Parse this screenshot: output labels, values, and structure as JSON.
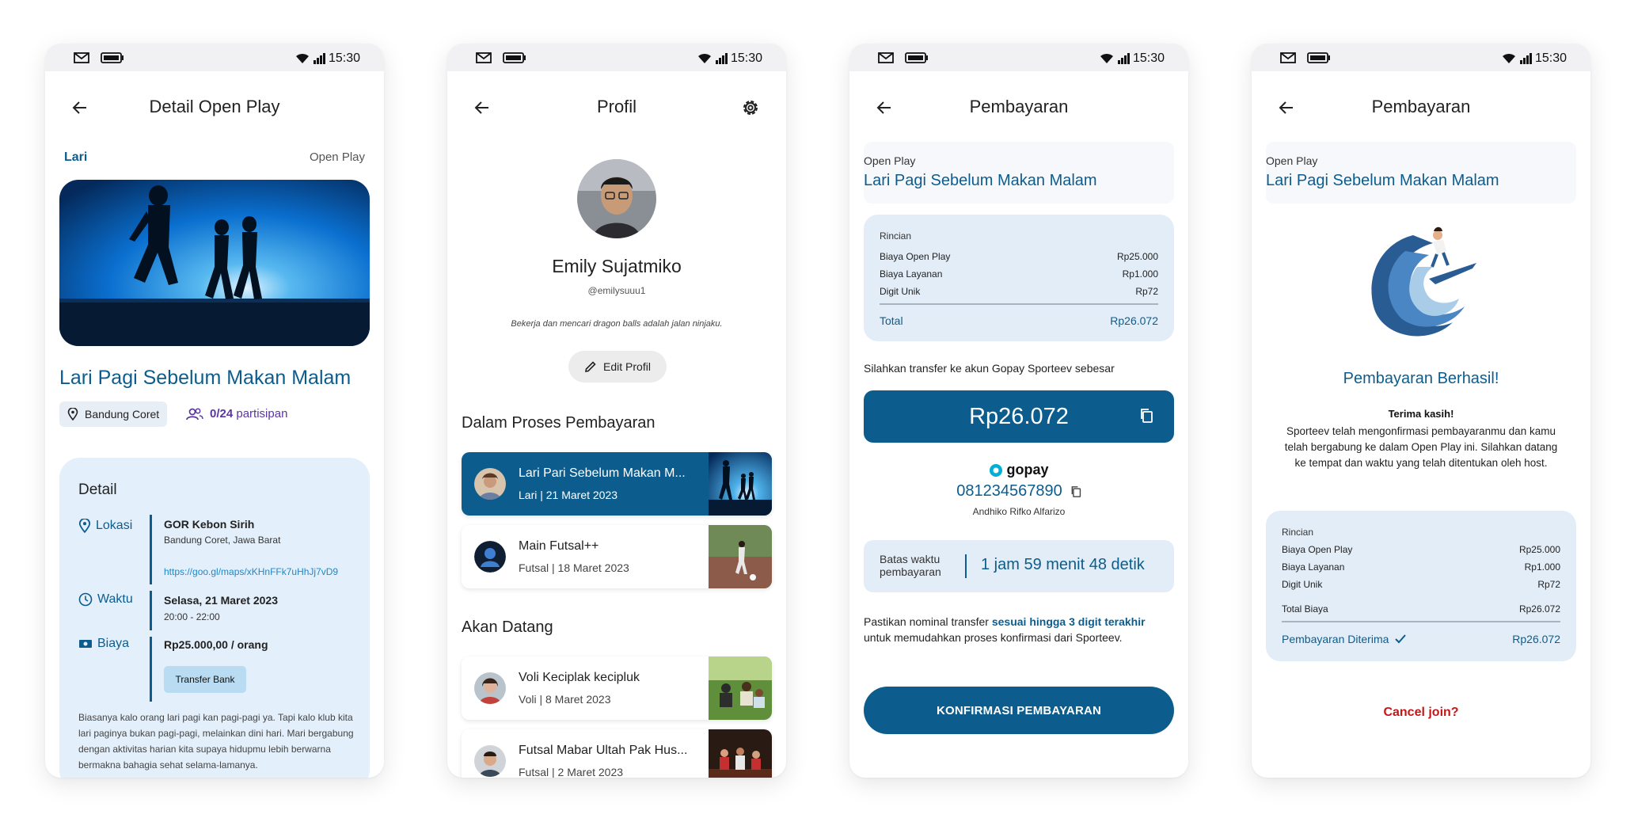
{
  "status_bar": {
    "time": "15:30"
  },
  "screen1": {
    "title": "Detail Open Play",
    "category": "Lari",
    "type": "Open Play",
    "event_title": "Lari Pagi Sebelum Makan Malam",
    "location_chip": "Bandung Coret",
    "participants_count": "0/24",
    "participants_label": "partisipan",
    "detail_title": "Detail",
    "lokasi_label": "Lokasi",
    "lokasi_name": "GOR Kebon Sirih",
    "lokasi_city": "Bandung Coret, Jawa Barat",
    "lokasi_link": "https://goo.gl/maps/xKHnFFk7uHhJj7vD9",
    "waktu_label": "Waktu",
    "waktu_date": "Selasa, 21 Maret 2023",
    "waktu_time": "20:00 - 22:00",
    "biaya_label": "Biaya",
    "biaya_value": "Rp25.000,00 / orang",
    "transfer_button": "Transfer Bank",
    "description": "Biasanya kalo orang lari pagi kan pagi-pagi ya. Tapi kalo klub kita lari paginya bukan pagi-pagi, melainkan dini hari. Mari bergabung dengan aktivitas harian kita supaya hidupmu lebih berwarna bermakna bahagia sehat selama-lamanya."
  },
  "screen2": {
    "title": "Profil",
    "name": "Emily Sujatmiko",
    "username": "@emilysuuu1",
    "bio": "Bekerja dan mencari dragon balls adalah jalan ninjaku.",
    "edit_button": "Edit Profil",
    "section_payment": "Dalam Proses Pembayaran",
    "payment_items": [
      {
        "title": "Lari Pari Sebelum Makan M...",
        "subtitle": "Lari | 21 Maret 2023"
      },
      {
        "title": "Main Futsal++",
        "subtitle": "Futsal | 18 Maret 2023"
      }
    ],
    "section_upcoming": "Akan Datang",
    "upcoming_items": [
      {
        "title": "Voli Keciplak kecipluk",
        "subtitle": "Voli | 8 Maret 2023"
      },
      {
        "title": "Futsal Mabar Ultah Pak Hus...",
        "subtitle": "Futsal | 2 Maret 2023"
      }
    ]
  },
  "screen3": {
    "title": "Pembayaran",
    "event_label": "Open Play",
    "event_title": "Lari Pagi Sebelum Makan Malam",
    "rincian_title": "Rincian",
    "rows": [
      {
        "label": "Biaya Open Play",
        "value": "Rp25.000"
      },
      {
        "label": "Biaya Layanan",
        "value": "Rp1.000"
      },
      {
        "label": "Digit Unik",
        "value": "Rp72"
      }
    ],
    "total_label": "Total",
    "total_value": "Rp26.072",
    "transfer_note": "Silahkan transfer ke akun Gopay Sporteev sebesar",
    "amount": "Rp26.072",
    "gopay_brand": "gopay",
    "phone_number": "081234567890",
    "account_name": "Andhiko Rifko Alfarizo",
    "deadline_label_1": "Batas waktu",
    "deadline_label_2": "pembayaran",
    "deadline_value": "1 jam 59 menit 48 detik",
    "note_prefix": "Pastikan nominal transfer ",
    "note_bold": "sesuai hingga 3 digit terakhir",
    "note_suffix": "untuk memudahkan proses konfirmasi dari Sporteev.",
    "confirm_button": "KONFIRMASI PEMBAYARAN"
  },
  "screen4": {
    "title": "Pembayaran",
    "event_label": "Open Play",
    "event_title": "Lari Pagi Sebelum Makan Malam",
    "success_title": "Pembayaran Berhasil!",
    "thanks": "Terima kasih!",
    "success_desc": "Sporteev telah mengonfirmasi pembayaranmu dan kamu telah bergabung ke dalam Open Play ini. Silahkan datang ke tempat dan waktu yang telah ditentukan oleh host.",
    "rincian_title": "Rincian",
    "rows": [
      {
        "label": "Biaya Open Play",
        "value": "Rp25.000"
      },
      {
        "label": "Biaya Layanan",
        "value": "Rp1.000"
      },
      {
        "label": "Digit Unik",
        "value": "Rp72"
      }
    ],
    "total_label": "Total Biaya",
    "total_value": "Rp26.072",
    "received_label": "Pembayaran Diterima",
    "received_value": "Rp26.072",
    "cancel": "Cancel join?"
  },
  "colors": {
    "primary": "#0c5d8e",
    "light_card": "#e3edf7",
    "cancel": "#c41818",
    "participants": "#5a35a3"
  }
}
